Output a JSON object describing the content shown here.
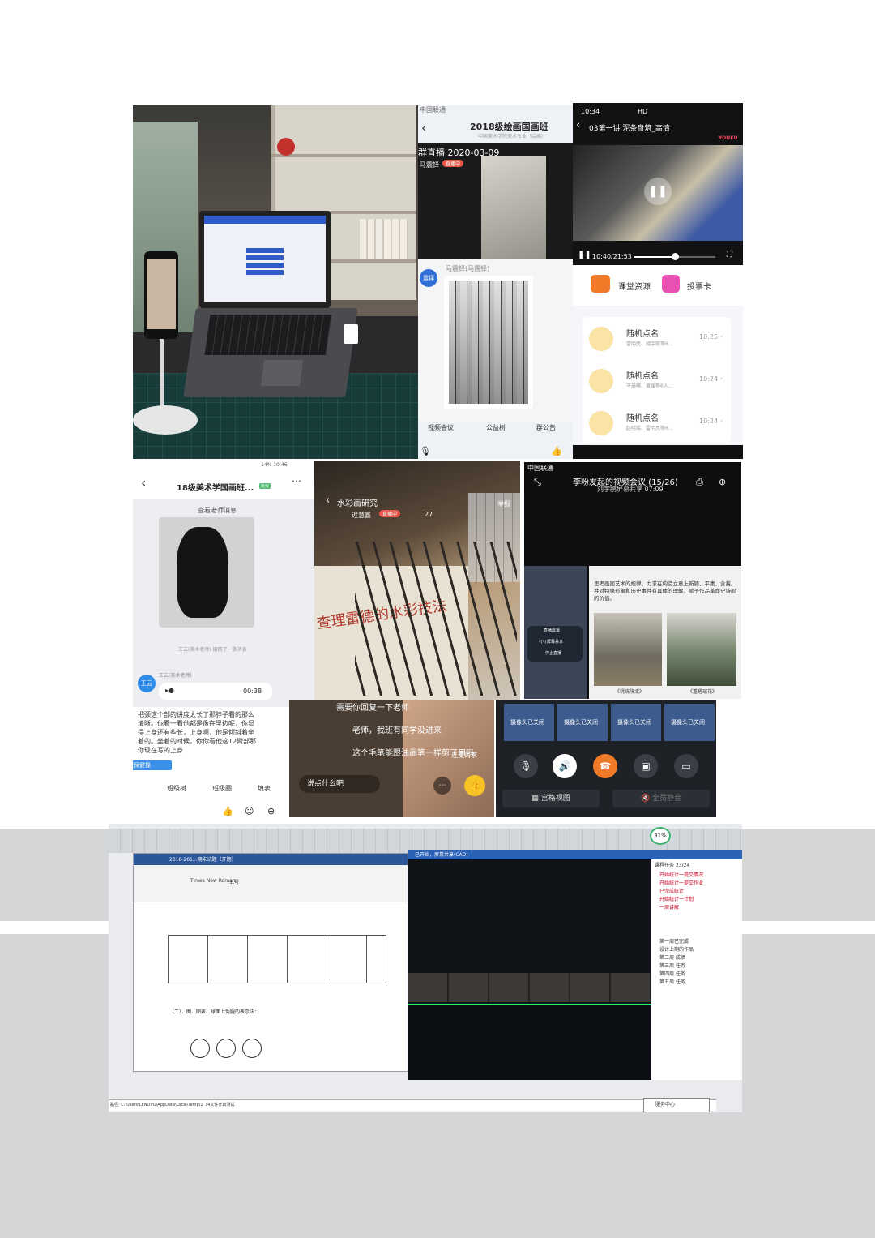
{
  "photo": {},
  "p2": {
    "status": "中国联通",
    "title": "2018级绘画国画班",
    "subtitle": "中国美术学院美术专业（绘画）",
    "live_banner": "群直播 2020-03-09",
    "host": "马震铎",
    "host_badge": "直播中",
    "poster": "马震铎(马震铎)",
    "avatar": "震铎",
    "bottom": [
      "视频会议",
      "公益树",
      "群公告"
    ]
  },
  "p3": {
    "time": "10:34",
    "network": "HD",
    "title": "03第一讲 泥条盘筑_高清",
    "brand": "YOUKU",
    "progress_time": "10:40/21:53",
    "progress": 0.5,
    "tabs": [
      "课堂资源",
      "投票卡"
    ],
    "items": [
      {
        "title": "随机点名",
        "sub": "雷明亮、胡宇航等6...",
        "time": "10:25"
      },
      {
        "title": "随机点名",
        "sub": "于晨曦、黄媛等6人...",
        "time": "10:24"
      },
      {
        "title": "随机点名",
        "sub": "赵晴瑶、雷明亮等6...",
        "time": "10:24"
      }
    ]
  },
  "p4": {
    "status_left": "",
    "status_right": "14% 10:46",
    "title": "18级美术学国画班...",
    "badge": "班级",
    "notice": "查看老师消息",
    "recall": "王云(美术老师) 撤回了一条消息",
    "sender": "王云(美术老师)",
    "avatar": "王云",
    "avatar_tag": "美术老师",
    "audio_time": "00:38",
    "text": "把颈这个部的讲度太长了那脖子看的那么清晰。你看一看他都是像在里边呢，你显得上身还有些长，上身啊，他是倾斜着坐着的。坐着的时候，你你看他这12臂部那你现在写的上身",
    "tip": "在家做保健操",
    "actions": [
      "打卡",
      "班级树",
      "班级圈",
      "填表"
    ]
  },
  "p5": {
    "title": "水彩画研究",
    "host": "迟慧鑫",
    "badge": "直播中",
    "viewers": "27",
    "report": "举报",
    "book": "查理雷德的水彩技法",
    "comments": [
      {
        "name": "",
        "text": "需要你回复一下老师"
      },
      {
        "name": "",
        "text": "老师，我班有同学没进来"
      },
      {
        "name": "",
        "text": "这个毛笔能跟油画笔一样剪了用吗"
      }
    ],
    "input": "说点什么吧",
    "link": "连麦请求"
  },
  "p6": {
    "carrier": "中国联通",
    "title": "李粉发起的视频会议 (15/26)",
    "sub": "刘宇鹏屏幕共享 07:09",
    "share_text": "思考画面艺术的规律，力求在构造立意上新颖，平庸，含蓄。并对特殊形象和历史事件有具体的理解，赋予作品革命史诗般的价值。",
    "captions": [
      "《桃统陕北》",
      "《重塔瑞花》"
    ],
    "popup": [
      "直播屏幕",
      "钉钉屏幕共享",
      "停止直播"
    ]
  },
  "p7": {
    "tiles": [
      "摄像头已关闭",
      "摄像头已关闭",
      "摄像头已关闭",
      "摄像头已关闭"
    ],
    "grid_view": "宫格视图",
    "mute_all": "全员静音"
  },
  "p8": {
    "battery": "31%",
    "doc_title": "2018-201...期末试题（开题）",
    "font": "Times New Roman",
    "size": "五号",
    "section": "（二）．图、图表、球面上兔腿的表示法：",
    "live_title": "已开始，屏幕共享(CAD)",
    "task_panel": "课程任务 23/24",
    "status_bar": "路径: C:\\Users\\LENOVO\\AppData\\Local\\Temp\\1_34文件开启测试",
    "bottom_notice": "服务中心",
    "tasks": [
      "开始统计一提交情况",
      "开始统计一提交作业",
      "已完成统计",
      "开始统计一计划",
      "一周讲解"
    ],
    "right_list": [
      "第一周已完成",
      "设计上期的作品",
      "第二周 成绩",
      "第三周 任务",
      "第四周 任务",
      "第五周 任务"
    ]
  },
  "colors": {
    "accent": "#1677ff",
    "red": "#e8584a",
    "orange": "#f07a28",
    "gray_band": "#d4d6d8"
  }
}
